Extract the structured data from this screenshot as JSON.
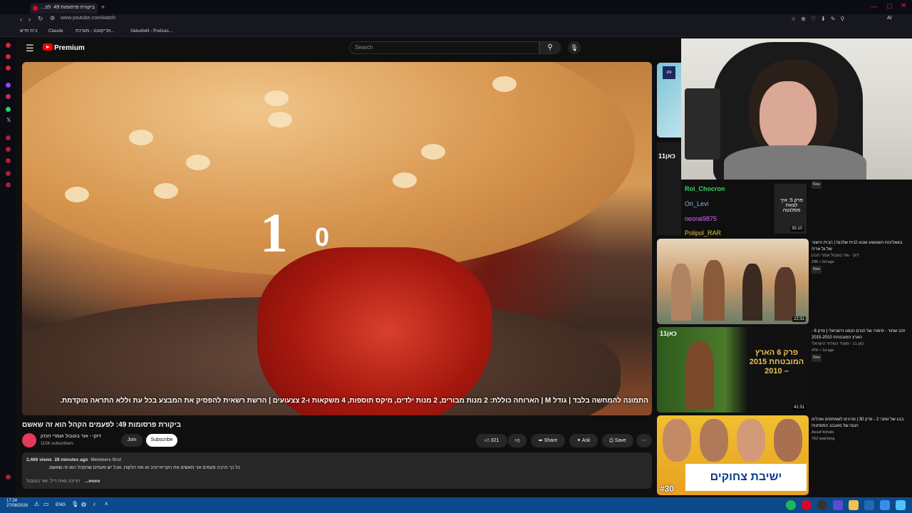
{
  "browser": {
    "active_tab_title": "ביקורת פרסומות 49: לפ...",
    "url": "www.youtube.com/watch",
    "bookmarks": [
      "בית חדש",
      "Claude",
      "אדיקאנט - מערכת...",
      "Valuebell - Podcas..."
    ]
  },
  "youtube": {
    "logo": "Premium",
    "search_placeholder": "Search"
  },
  "video": {
    "countdown_1": "1",
    "countdown_0": "0",
    "caption": "התמונה להמחשה בלבד | גודל M | הארוחה כוללת: 2 מנות מבורים, 2 מנות ילדים, מיקס תוספות, 4 משקאות ו-2 צצעועים | הרשת רשאית להפסיק את המבצע בכל עת וללא התראה מוקדמת.",
    "title": "ביקורת פרסומות 49: לפעמים הקהל הוא זה שאשם",
    "channel": "דוקי - אור בוטבול ועמרי הכהן",
    "subscribers": "110K subscribers",
    "join": "Join",
    "subscribe": "Subscribe",
    "likes": "321",
    "share": "Share",
    "ask": "Ask",
    "save": "Save",
    "more_icon": "⋯",
    "views": "2,466 views",
    "age": "28 minutes ago",
    "members": "Members first",
    "desc_line1": "כל כך הרבה פעמים אני מאשים את הקריאייטיב או את הלקוח, אבל יש פעמים שהקהל הוא זה שאשם.",
    "desc_line2": "...more",
    "desc_credit": "הריכה גאיה דיל: אור בוטבול"
  },
  "chat": [
    {
      "user": "Roi_Chocron",
      "color": "#3ecf6b"
    },
    {
      "user": "Ori_Levi",
      "color": "#8ab4f8"
    },
    {
      "user": "neorai9875",
      "color": "#d96aff"
    },
    {
      "user": "Polipol_RAR",
      "color": "#e0c341"
    }
  ],
  "recommendations": [
    {
      "duration": "35:10",
      "badge": "New",
      "thumb_text": "פרק 5: איך לצאת מפלנטה"
    },
    {
      "title": "באאליבוח השעשוע שבא לבית שלכם! | הבית הישנוי של גל אריה",
      "channel": "דוקי - אור בוטבול ועמרי הכהן",
      "meta": "29K • 2d ago",
      "badge": "New",
      "duration": "22:31"
    },
    {
      "title": "זהב שחור - סיפורו של הנרם הנפט הישראלי | פרק 6 - הארץ המובטחת 2015-2010",
      "channel": "כאן 11 - תאגיד השידור הישראלי",
      "meta": "47K • 1d ago",
      "badge": "New",
      "duration": "41:31",
      "thumb_text": "פרק 6 הארץ המובטחת 2015 – 2010"
    },
    {
      "title": "בבג של זומבי 2 - פרק 30 | מכינים לשאתסים אוכלים הנגה של מאבנב הפסתנה!",
      "channel": "Assaf Itzhaki",
      "meta": "763 watching",
      "thumb_text": "ישיבת צחוקים",
      "episode": "#30"
    }
  ],
  "taskbar": {
    "time": "17:24",
    "date": "27/08/2026",
    "lang": "ENG"
  }
}
